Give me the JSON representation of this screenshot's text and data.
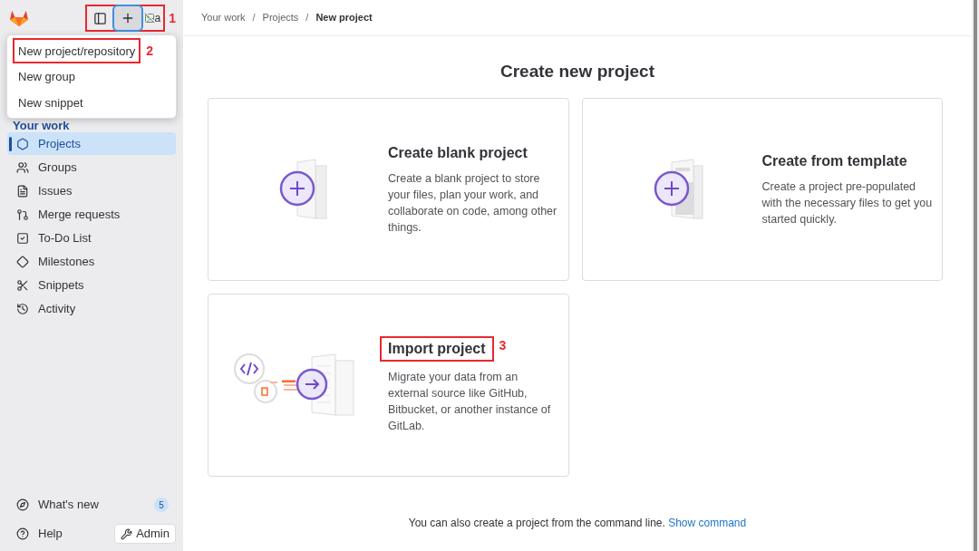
{
  "sidebar": {
    "avatar_alt": "a",
    "header_annotation": "1",
    "nav_heading": "Your work",
    "items": [
      {
        "label": "Projects",
        "selected": true
      },
      {
        "label": "Groups",
        "selected": false
      },
      {
        "label": "Issues",
        "selected": false
      },
      {
        "label": "Merge requests",
        "selected": false
      },
      {
        "label": "To-Do List",
        "selected": false
      },
      {
        "label": "Milestones",
        "selected": false
      },
      {
        "label": "Snippets",
        "selected": false
      },
      {
        "label": "Activity",
        "selected": false
      }
    ],
    "whats_new": {
      "label": "What's new",
      "count": "5"
    },
    "help": "Help",
    "admin": "Admin"
  },
  "new_menu": {
    "expanded": true,
    "items": [
      {
        "label": "New project/repository",
        "annotation": "2"
      },
      {
        "label": "New group"
      },
      {
        "label": "New snippet"
      }
    ]
  },
  "breadcrumbs": [
    "Your work",
    "Projects",
    "New project"
  ],
  "breadcrumb_separator": "/",
  "page_title": "Create new project",
  "cards": [
    {
      "kind": "blank",
      "title": "Create blank project",
      "description": "Create a blank project to store your files, plan your work, and collaborate on code, among other things."
    },
    {
      "kind": "template",
      "title": "Create from template",
      "description": "Create a project pre-populated with the necessary files to get you started quickly."
    },
    {
      "kind": "import",
      "title": "Import project",
      "description": "Migrate your data from an external source like GitHub, Bitbucket, or another instance of GitLab.",
      "annotation": "3"
    }
  ],
  "footer": {
    "text": "You can also create a project from the command line.",
    "link": "Show command"
  }
}
